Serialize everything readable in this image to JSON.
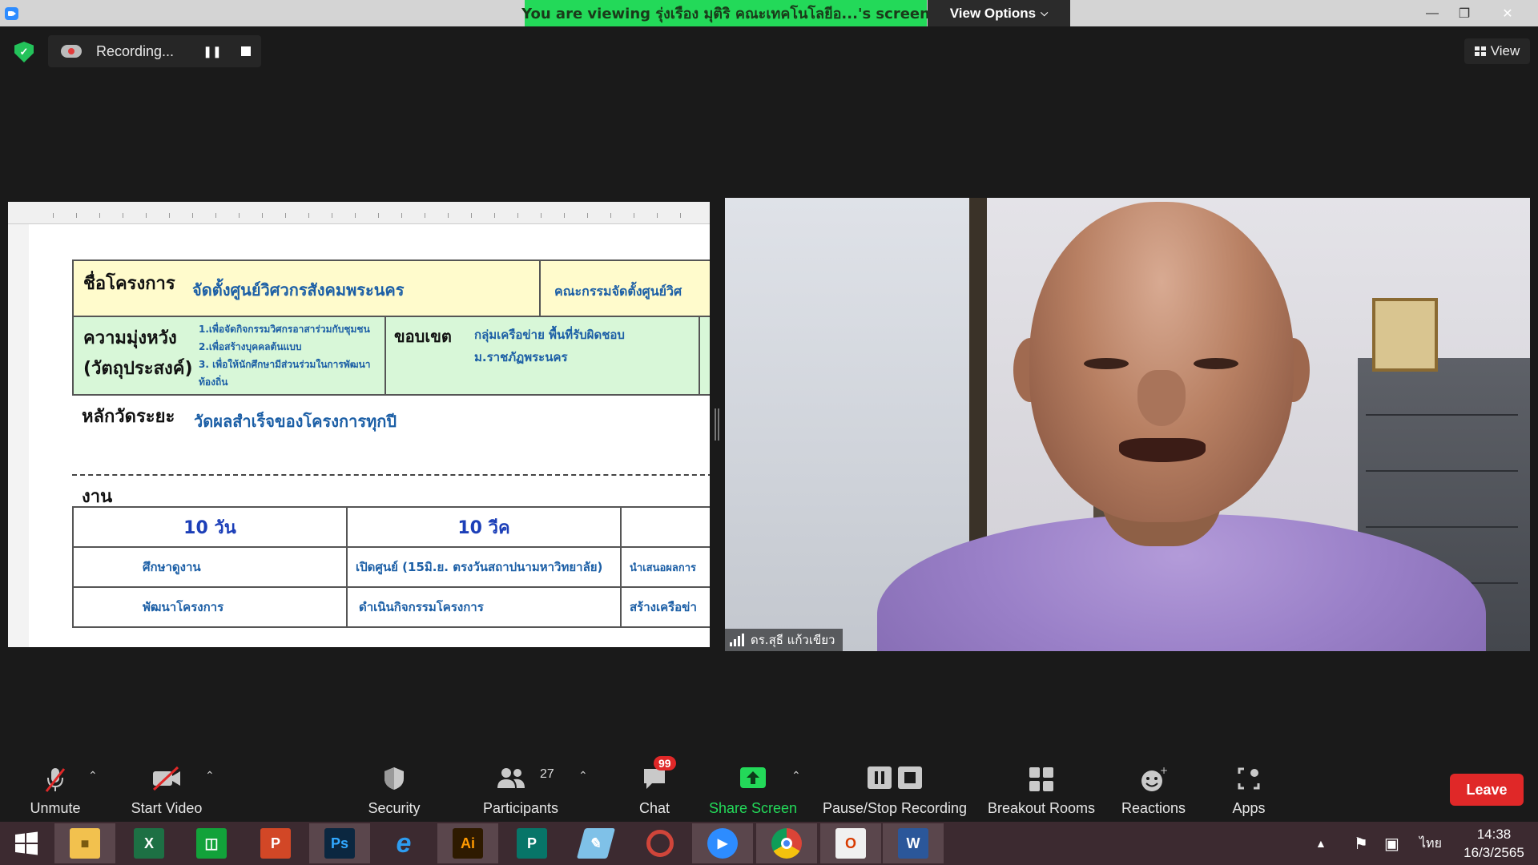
{
  "window": {
    "viewing_banner": "You are viewing รุ่งเรือง มุติริ คณะเทคโนโลยีอ...'s screen",
    "view_options": "View Options"
  },
  "meeting_top": {
    "recording_label": "Recording...",
    "view_label": "View"
  },
  "shared_doc": {
    "project_label": "ชื่อโครงการ",
    "project_value": "จัดตั้งศูนย์วิศวกรสังคมพระนคร",
    "committee_value": "คณะกรรมจัดตั้งศูนย์วิศ",
    "expectation_label_1": "ความมุ่งหวัง",
    "expectation_label_2": "(วัตถุประสงค์)",
    "objectives": [
      "1.เพื่อจัดกิจกรรมวิศกรอาสาร่วมกับชุมชน",
      "2.เพื่อสร้างบุคคลต้นแบบ",
      "3. เพื่อให้นักศึกษามีส่วนร่วมในการพัฒนา",
      "ท้องถิ่น"
    ],
    "scope_label": "ขอบเขต",
    "scope_value_1": "กลุ่มเครือข่าย พื้นที่รับผิดชอบ",
    "scope_value_2": "ม.ราชภัฏพระนคร",
    "kpi_label": "หลักวัดระยะ",
    "kpi_value": "วัดผลสำเร็จของโครงการทุกปี",
    "work_label": "งาน",
    "table_headers": [
      "10 วัน",
      "10 วีค"
    ],
    "table_rows": [
      [
        "ศึกษาดูงาน",
        "เปิดศูนย์ (15มิ.ย. ตรงวันสถาปนามหาวิทยาลัย)",
        "นำเสนอผลการ"
      ],
      [
        "พัฒนาโครงการ",
        "ดำเนินกิจกรรมโครงการ",
        "สร้างเครือข่า"
      ]
    ]
  },
  "video": {
    "participant_name": "ดร.สุธี  แก้วเขียว"
  },
  "toolbar": {
    "unmute": "Unmute",
    "start_video": "Start Video",
    "security": "Security",
    "participants": "Participants",
    "participants_count": "27",
    "chat": "Chat",
    "chat_badge": "99",
    "share_screen": "Share Screen",
    "pause_stop_recording": "Pause/Stop Recording",
    "breakout_rooms": "Breakout Rooms",
    "reactions": "Reactions",
    "apps": "Apps",
    "leave": "Leave"
  },
  "taskbar": {
    "apps": [
      "windows-start",
      "file-explorer",
      "excel",
      "store",
      "powerpoint",
      "photoshop",
      "internet-explorer",
      "illustrator",
      "publisher",
      "notepad",
      "photoscape",
      "zoom",
      "chrome",
      "office",
      "word"
    ],
    "language": "ไทย",
    "time": "14:38",
    "date": "16/3/2565"
  },
  "colors": {
    "banner_green": "#23d959",
    "leave_red": "#e02828",
    "share_green": "#23d959",
    "badge_red": "#e02828"
  }
}
